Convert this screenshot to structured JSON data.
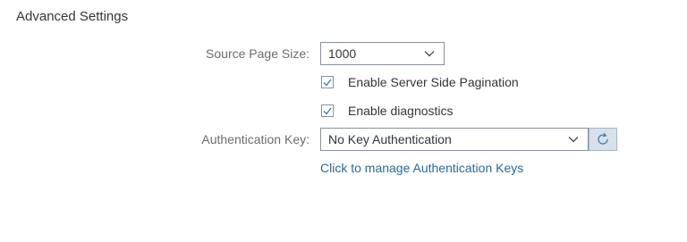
{
  "section": {
    "title": "Advanced Settings"
  },
  "source_page_size": {
    "label": "Source Page Size:",
    "value": "1000"
  },
  "options": {
    "server_side_pagination": {
      "label": "Enable Server Side Pagination",
      "checked": true
    },
    "diagnostics": {
      "label": "Enable diagnostics",
      "checked": true
    }
  },
  "authentication": {
    "label": "Authentication Key:",
    "value": "No Key Authentication",
    "manage_link": "Click to manage Authentication Keys"
  },
  "icons": {
    "dropdown": "chevron-down-icon",
    "checkmark": "checkmark-icon",
    "refresh": "refresh-icon"
  },
  "colors": {
    "link": "#2a6a93",
    "label": "#6a6d70",
    "border": "#89919a",
    "refresh_button_bg": "#d8e1ea"
  }
}
